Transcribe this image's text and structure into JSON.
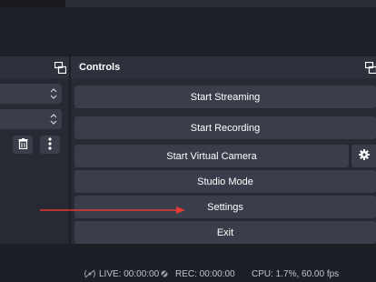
{
  "colors": {
    "background": "#1d1f26",
    "panel": "#272a33",
    "panel_header": "#2e313b",
    "button": "#3a3e4a",
    "text": "#ffffff",
    "status_text": "#bfc3cc",
    "annotation_arrow": "#e53935"
  },
  "controls": {
    "title": "Controls",
    "buttons": {
      "start_streaming": "Start Streaming",
      "start_recording": "Start Recording",
      "start_virtual_camera": "Start Virtual Camera",
      "studio_mode": "Studio Mode",
      "settings": "Settings",
      "exit": "Exit"
    },
    "icons": {
      "undock": "undock-icon",
      "virtual_camera_settings": "gear-icon"
    }
  },
  "left_dock": {
    "icons": [
      "undock-icon",
      "spin-arrows-icon",
      "trash-icon",
      "more-vertical-icon"
    ]
  },
  "annotation": {
    "arrow_target": "Settings"
  },
  "status_bar": {
    "live": "LIVE: 00:00:00",
    "rec": "REC: 00:00:00",
    "cpu": "CPU: 1.7%, 60.00 fps"
  }
}
